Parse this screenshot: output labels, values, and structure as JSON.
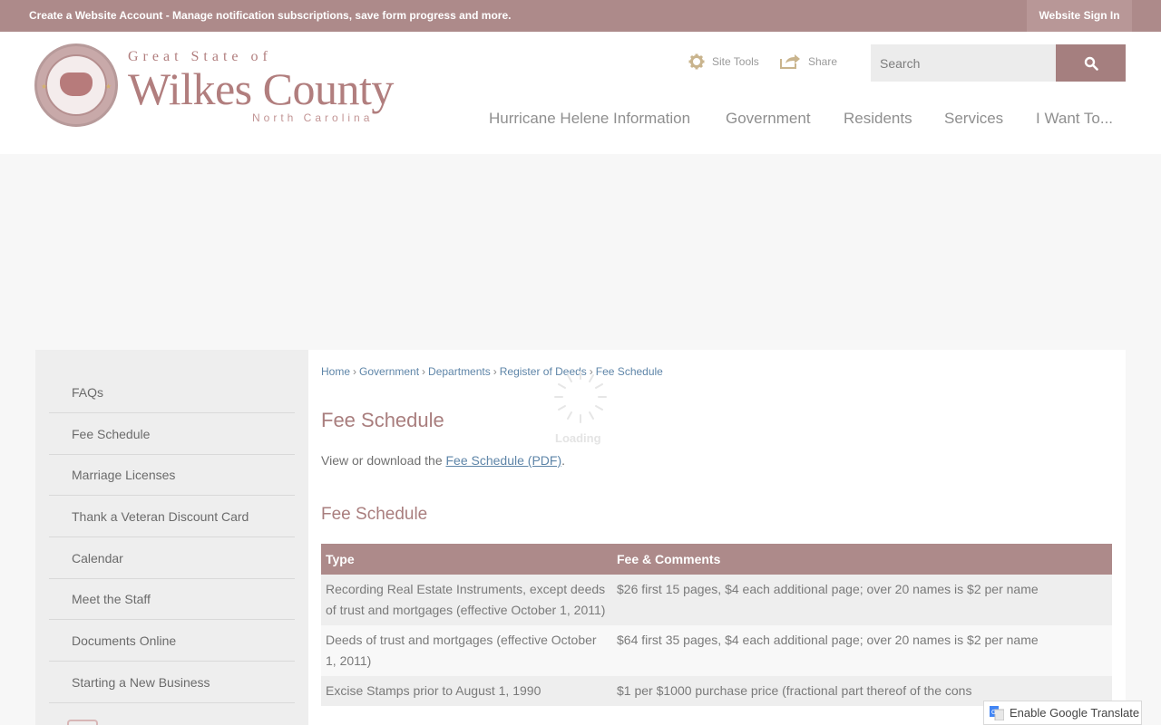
{
  "topbar": {
    "message": "Create a Website Account - Manage notification subscriptions, save form progress and more.",
    "signin_label": "Website Sign In"
  },
  "logo": {
    "line1": "Great State of",
    "line2": "Wilkes County",
    "line3": "North Carolina"
  },
  "tools": {
    "site_tools_label": "Site Tools",
    "share_label": "Share"
  },
  "search": {
    "placeholder": "Search",
    "value": ""
  },
  "nav": {
    "items": [
      {
        "label": "Hurricane Helene Information"
      },
      {
        "label": "Government"
      },
      {
        "label": "Residents"
      },
      {
        "label": "Services"
      },
      {
        "label": "I Want To..."
      }
    ]
  },
  "sidebar": {
    "items": [
      {
        "label": "FAQs"
      },
      {
        "label": "Fee Schedule"
      },
      {
        "label": "Marriage Licenses"
      },
      {
        "label": "Thank a Veteran Discount Card"
      },
      {
        "label": "Calendar"
      },
      {
        "label": "Meet the Staff"
      },
      {
        "label": "Documents Online"
      },
      {
        "label": "Starting a New Business"
      }
    ]
  },
  "breadcrumb": {
    "items": [
      {
        "label": "Home"
      },
      {
        "label": "Government"
      },
      {
        "label": "Departments"
      },
      {
        "label": "Register of Deeds"
      },
      {
        "label": "Fee Schedule"
      }
    ]
  },
  "loading_text": "Loading",
  "main": {
    "title": "Fee Schedule",
    "intro_prefix": "View or download the ",
    "intro_link": "Fee Schedule (PDF)",
    "intro_suffix": ".",
    "section_title": "Fee Schedule",
    "table": {
      "headers": [
        "Type",
        "Fee & Comments"
      ],
      "rows": [
        [
          "Recording Real Estate Instruments, except deeds of trust and mortgages (effective October 1, 2011)",
          "$26 first 15 pages, $4 each additional page; over 20 names is $2 per name"
        ],
        [
          "Deeds of trust and mortgages (effective October 1, 2011)",
          "$64 first 35 pages, $4 each additional page; over 20 names is $2 per name"
        ],
        [
          "Excise Stamps prior to August 1, 1990",
          "$1 per $1000 purchase price (fractional part thereof of the cons"
        ]
      ]
    }
  },
  "translate": {
    "label": "Enable Google Translate"
  }
}
